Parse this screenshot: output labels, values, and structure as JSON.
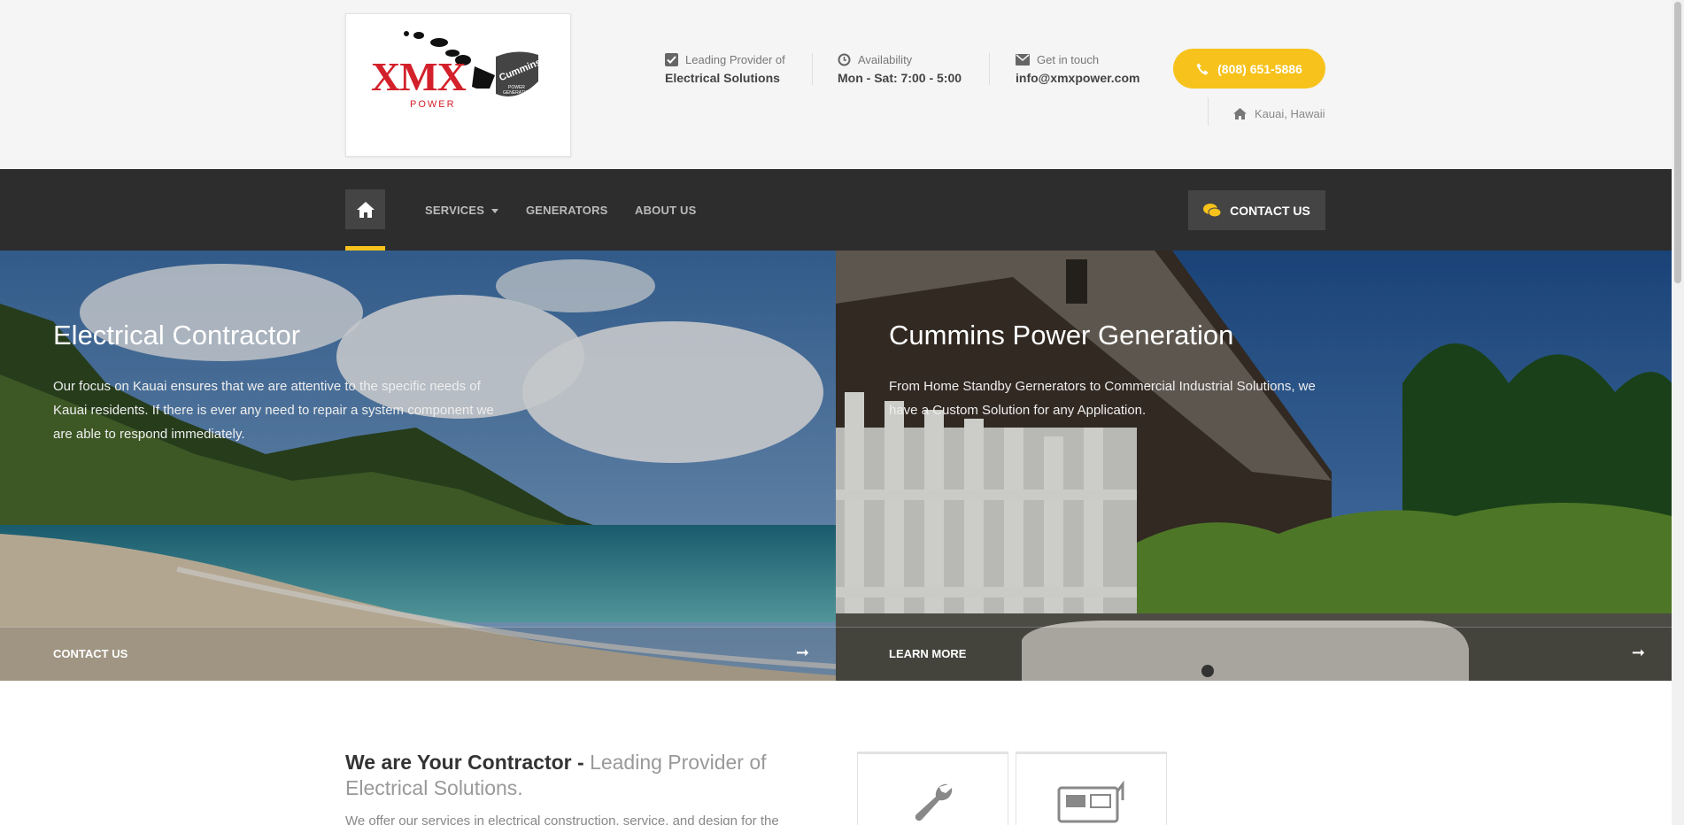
{
  "header": {
    "logo": {
      "brand": "XMX",
      "sub": "POWER",
      "partner": "Cummins",
      "partner_sub": "POWER GENERATION"
    },
    "info": [
      {
        "icon": "checkbox-icon",
        "label": "Leading Provider of",
        "value": "Electrical Solutions"
      },
      {
        "icon": "clock-icon",
        "label": "Availability",
        "value": "Mon - Sat: 7:00 - 5:00"
      },
      {
        "icon": "envelope-icon",
        "label": "Get in touch",
        "value": "info@xmxpower.com"
      }
    ],
    "phone": "(808) 651-5886",
    "location": "Kauai, Hawaii"
  },
  "nav": {
    "items": [
      "SERVICES",
      "GENERATORS",
      "ABOUT US"
    ],
    "contact": "CONTACT US"
  },
  "hero": [
    {
      "title": "Electrical Contractor",
      "text": "Our focus on Kauai ensures that we are attentive to the specific needs of Kauai residents. If there is ever any need to repair a system component we are able to respond immediately.",
      "cta": "CONTACT US"
    },
    {
      "title": "Cummins Power Generation",
      "text": "From Home Standby Gernerators to Commercial Industrial Solutions, we have a Custom Solution for any Application.",
      "cta": "LEARN MORE"
    }
  ],
  "intro": {
    "title_bold": "We are Your Contractor -",
    "title_light": "Leading Provider of Electrical Solutions.",
    "text": "We offer our services in electrical construction, service, and design for the"
  },
  "colors": {
    "accent": "#f7c21b",
    "nav_bg": "#2d2d2d",
    "brand_red": "#d3212b"
  }
}
